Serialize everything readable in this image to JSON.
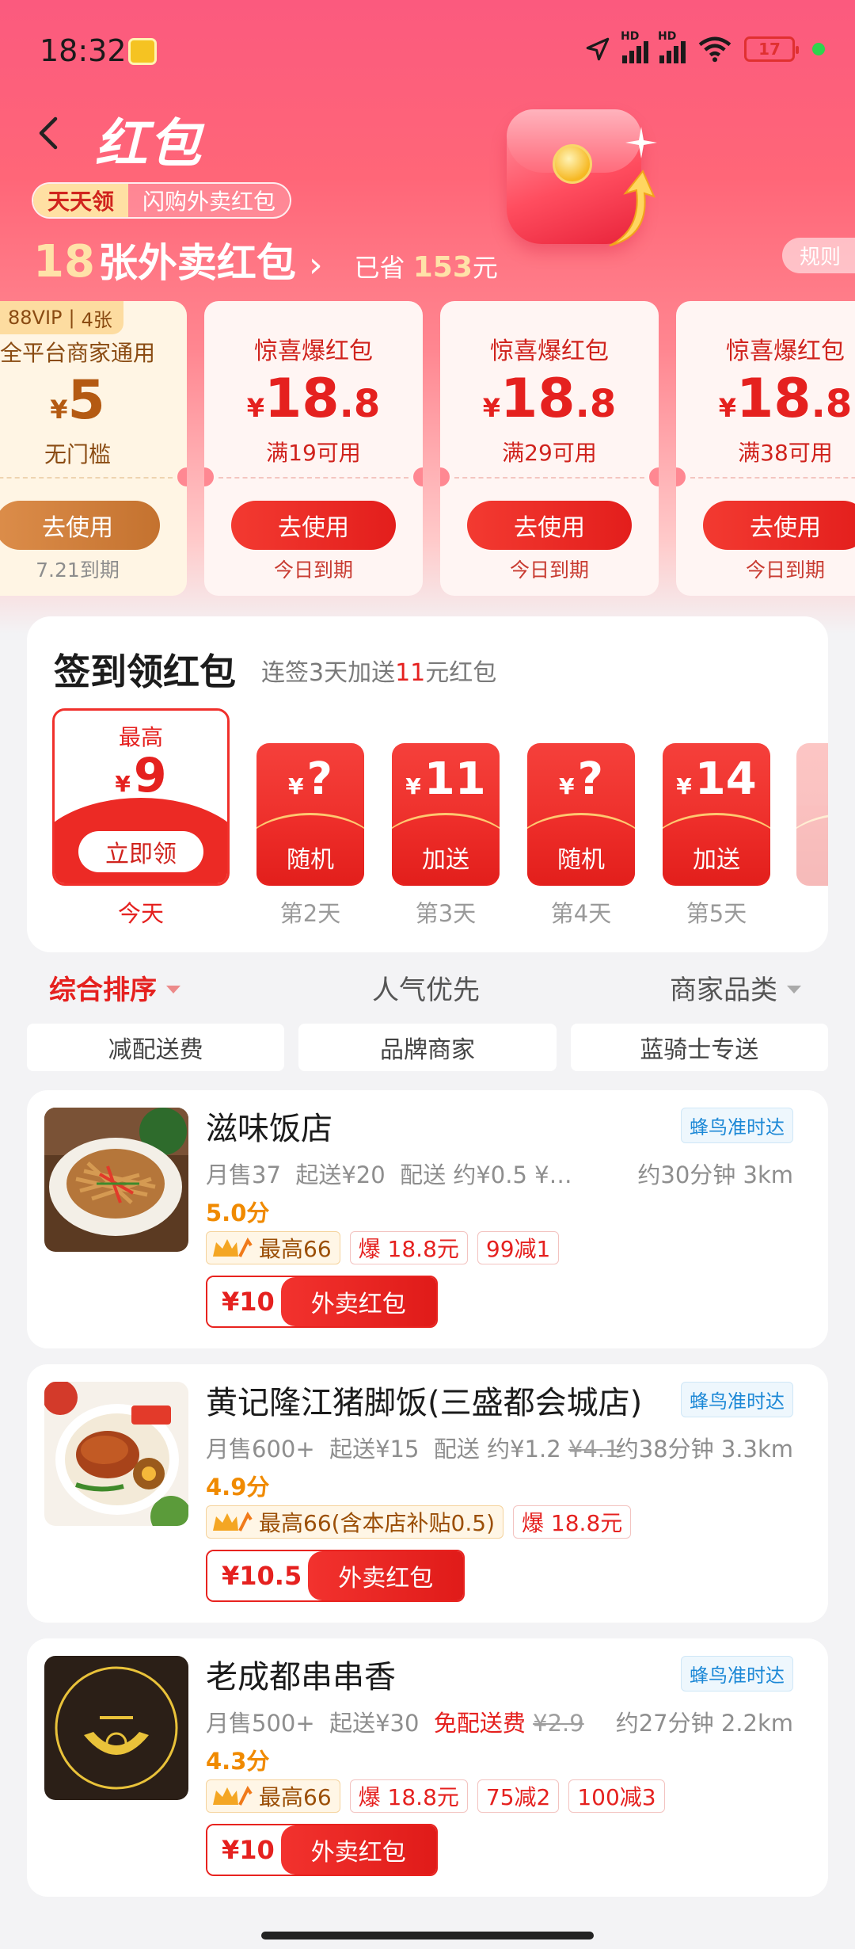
{
  "status": {
    "time": "18:32",
    "battery": "17"
  },
  "header": {
    "title": "红包",
    "promo_left": "天天领",
    "promo_right": "闪购外卖红包",
    "count": "18",
    "count_label": "张外卖红包",
    "saved_prefix": "已省",
    "saved_value": "153",
    "saved_suffix": "元",
    "rules": "规则"
  },
  "coupons": [
    {
      "tag1": "88VIP",
      "tag2": "4张",
      "title": "全平台商家通用",
      "yen": "¥",
      "int": "5",
      "dec": "",
      "cond": "无门槛",
      "button": "去使用",
      "expire": "7.21到期"
    },
    {
      "title": "惊喜爆红包",
      "yen": "¥",
      "int": "18",
      "dec": ".8",
      "cond": "满19可用",
      "button": "去使用",
      "expire": "今日到期"
    },
    {
      "title": "惊喜爆红包",
      "yen": "¥",
      "int": "18",
      "dec": ".8",
      "cond": "满29可用",
      "button": "去使用",
      "expire": "今日到期"
    },
    {
      "title": "惊喜爆红包",
      "yen": "¥",
      "int": "18",
      "dec": ".8",
      "cond": "满38可用",
      "button": "去使用",
      "expire": "今日到期"
    }
  ],
  "checkin": {
    "title": "签到领红包",
    "sub_pre": "连签3天加送",
    "sub_num": "11",
    "sub_post": "元红包",
    "today": {
      "top": "最高",
      "yen": "¥",
      "value": "9",
      "button": "立即领",
      "label": "今天"
    },
    "days": [
      {
        "yen": "¥",
        "value": "?",
        "tag": "随机",
        "label": "第2天"
      },
      {
        "yen": "¥",
        "value": "11",
        "tag": "加送",
        "label": "第3天"
      },
      {
        "yen": "¥",
        "value": "?",
        "tag": "随机",
        "label": "第4天"
      },
      {
        "yen": "¥",
        "value": "14",
        "tag": "加送",
        "label": "第5天"
      }
    ]
  },
  "sort": {
    "comprehensive": "综合排序",
    "popular": "人气优先",
    "category": "商家品类"
  },
  "chips": [
    "减配送费",
    "品牌商家",
    "蓝骑士专送"
  ],
  "shops": [
    {
      "name": "滋味饭店",
      "badge": "蜂鸟准时达",
      "monthly": "月售37",
      "min": "起送¥20",
      "delivery": "配送 约¥0.5 ¥…",
      "delivery_strike": "",
      "distance": "约30分钟 3km",
      "score": "5.0分",
      "tags": [
        "最高66",
        "爆 18.8元",
        "99减1"
      ],
      "pack_value": "¥10",
      "pack_text": "外卖红包"
    },
    {
      "name": "黄记隆江猪脚饭(三盛都会城店)",
      "badge": "蜂鸟准时达",
      "monthly": "月售600+",
      "min": "起送¥15",
      "delivery": "配送 约¥1.2",
      "delivery_strike": "¥4.1",
      "distance": "约38分钟 3.3km",
      "score": "4.9分",
      "tags": [
        "最高66(含本店补贴0.5)",
        "爆 18.8元"
      ],
      "pack_value": "¥10.5",
      "pack_text": "外卖红包"
    },
    {
      "name": "老成都串串香",
      "badge": "蜂鸟准时达",
      "monthly": "月售500+",
      "min": "起送¥30",
      "delivery": "免配送费",
      "delivery_strike": "¥2.9",
      "distance": "约27分钟 2.2km",
      "score": "4.3分",
      "tags": [
        "最高66",
        "爆 18.8元",
        "75减2",
        "100减3"
      ],
      "pack_value": "¥10",
      "pack_text": "外卖红包",
      "logo_text": "老成都串串香"
    }
  ]
}
